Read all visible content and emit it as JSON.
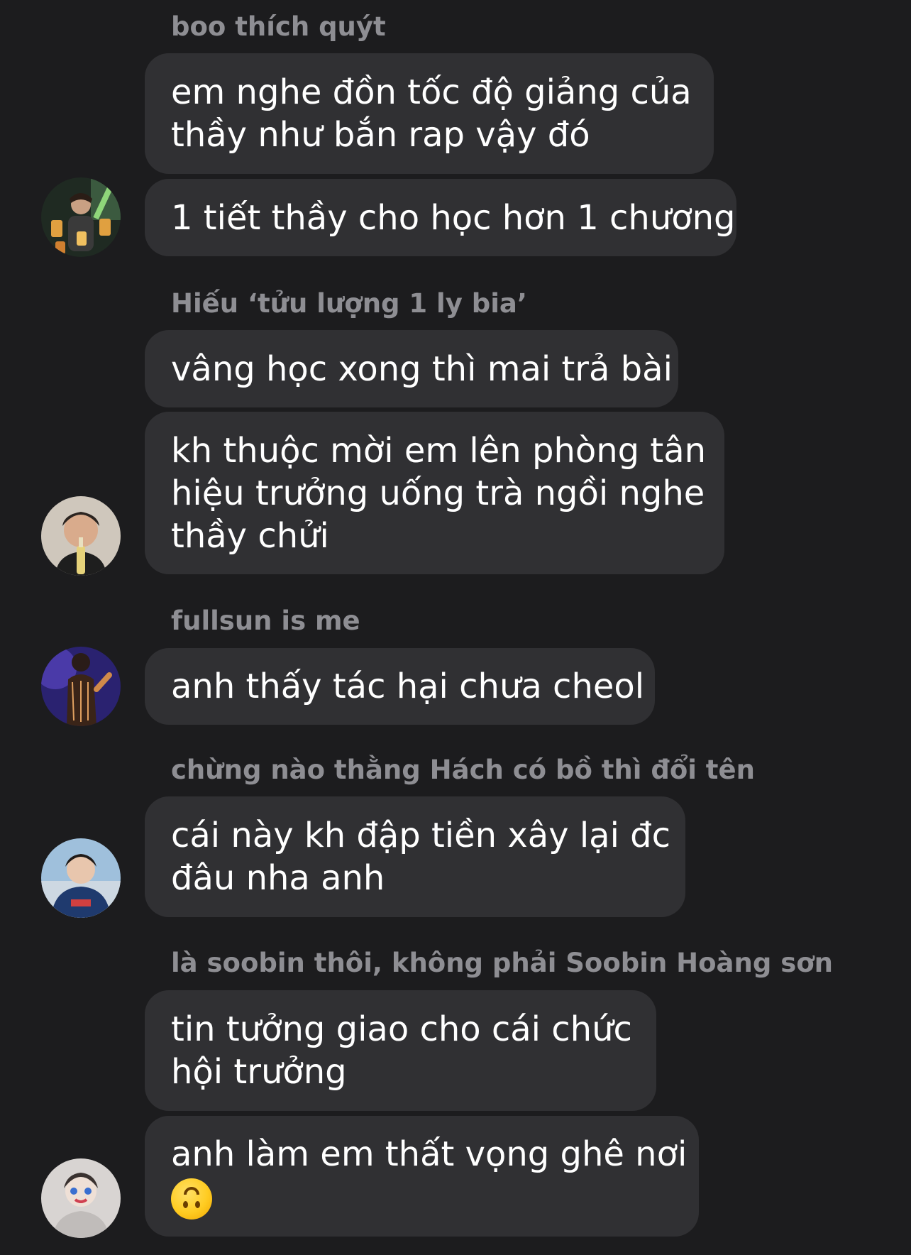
{
  "messages": [
    {
      "sender": "boo thích quýt",
      "bubbles": [
        {
          "lines": [
            "em nghe đồn tốc độ giảng của",
            "thầy như bắn rap vậy đó"
          ]
        },
        {
          "lines": [
            "1 tiết thầy cho học hơn 1 chương"
          ]
        }
      ]
    },
    {
      "sender": "Hiếu ‘tửu lượng 1 ly bia’",
      "bubbles": [
        {
          "lines": [
            "vâng học xong thì mai trả bài"
          ]
        },
        {
          "lines": [
            "kh thuộc mời em lên phòng tân",
            "hiệu trưởng uống trà ngồi nghe",
            "thầy chửi"
          ]
        }
      ]
    },
    {
      "sender": "fullsun is me",
      "bubbles": [
        {
          "lines": [
            "anh thấy tác hại chưa cheol"
          ]
        }
      ]
    },
    {
      "sender": "chừng nào thằng Hách có bồ thì đổi tên",
      "bubbles": [
        {
          "lines": [
            "cái này kh đập tiền xây lại đc",
            "đâu nha anh"
          ]
        }
      ]
    },
    {
      "sender": "là soobin thôi, không phải Soobin Hoàng sơn",
      "bubbles": [
        {
          "lines": [
            "tin tưởng giao cho cái chức",
            "hội trưởng"
          ]
        },
        {
          "lines": [
            "anh làm em thất vọng ghê nơi"
          ],
          "emoji": "upside-down-face-emoji"
        }
      ]
    }
  ],
  "colors": {
    "background": "#1c1c1e",
    "bubble": "#303033",
    "sender_name": "#8e8e93",
    "text": "#ffffff"
  }
}
